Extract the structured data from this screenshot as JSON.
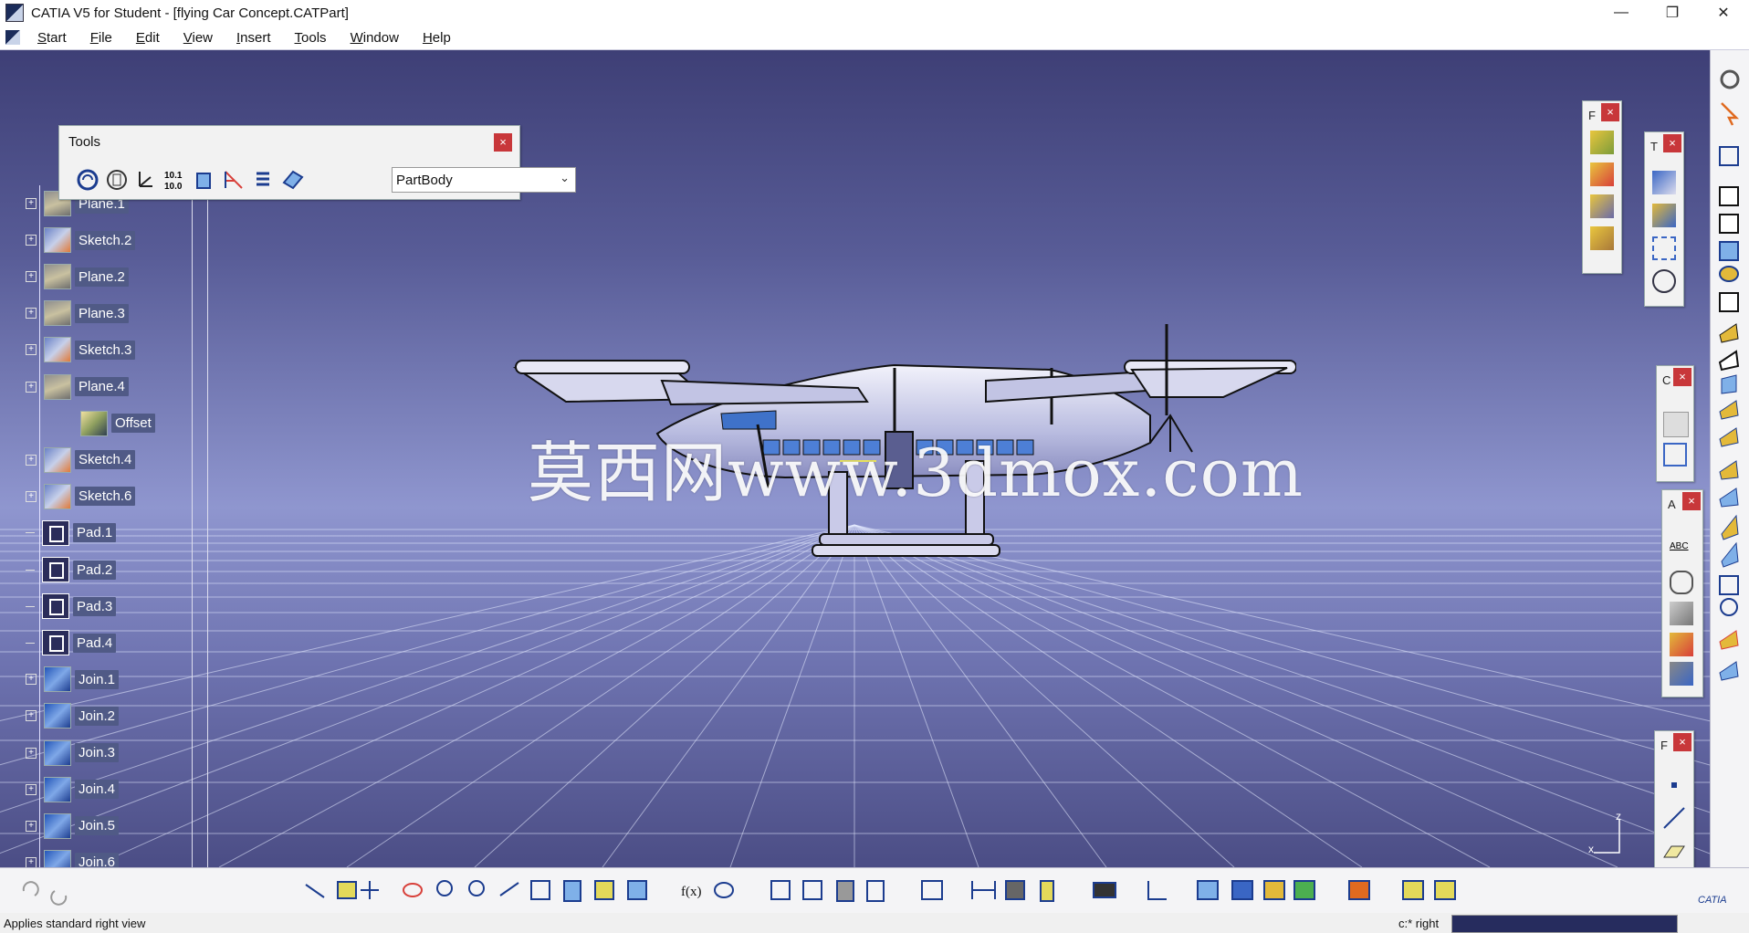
{
  "window": {
    "title": "CATIA V5 for Student - [flying Car Concept.CATPart]",
    "controls": [
      "—",
      "❐",
      "✕"
    ]
  },
  "menu": [
    "Start",
    "File",
    "Edit",
    "View",
    "Insert",
    "Tools",
    "Window",
    "Help"
  ],
  "mdi_controls": [
    "–",
    "⧉",
    "✕"
  ],
  "tools_panel": {
    "title": "Tools",
    "close": "×",
    "body_select": "PartBody",
    "icons": [
      "update-icon",
      "hand-icon",
      "axis-icon",
      "measure-icon",
      "cube-icon",
      "tree-icon",
      "list-icon",
      "book-icon"
    ]
  },
  "tree": [
    {
      "label": "Plane.1",
      "type": "plane"
    },
    {
      "label": "Sketch.2",
      "type": "sketch"
    },
    {
      "label": "Plane.2",
      "type": "plane"
    },
    {
      "label": "Plane.3",
      "type": "plane"
    },
    {
      "label": "Sketch.3",
      "type": "sketch"
    },
    {
      "label": "Plane.4",
      "type": "plane"
    },
    {
      "label": "Offset",
      "type": "offset"
    },
    {
      "label": "Sketch.4",
      "type": "sketch"
    },
    {
      "label": "Sketch.6",
      "type": "sketch"
    },
    {
      "label": "Pad.1",
      "type": "pad"
    },
    {
      "label": "Pad.2",
      "type": "pad"
    },
    {
      "label": "Pad.3",
      "type": "pad"
    },
    {
      "label": "Pad.4",
      "type": "pad"
    },
    {
      "label": "Join.1",
      "type": "join"
    },
    {
      "label": "Join.2",
      "type": "join"
    },
    {
      "label": "Join.3",
      "type": "join"
    },
    {
      "label": "Join.4",
      "type": "join"
    },
    {
      "label": "Join.5",
      "type": "join"
    },
    {
      "label": "Join.6",
      "type": "join"
    }
  ],
  "floating_toolbars": {
    "tb1_label": "F",
    "tb2_label": "T",
    "tb3_label": "C",
    "tb4_label": "A",
    "tb5_label": "F",
    "close": "×",
    "tb4_abc": "ABC"
  },
  "watermark": "莫西网www.3dmox.com",
  "axis": {
    "z": "z",
    "x": "x"
  },
  "status": {
    "message": "Applies standard right view",
    "command_label": "c:* right"
  },
  "colors": {
    "bg_top": "#3e3f76",
    "bg_mid": "#8f96cf",
    "tree_label": "#505a86",
    "close_red": "#c8373a"
  }
}
